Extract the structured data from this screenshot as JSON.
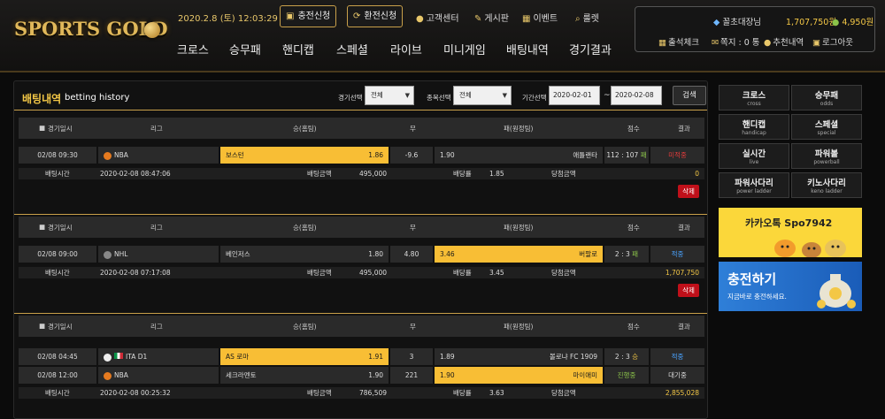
{
  "header": {
    "logo": "SPORTS GOLD",
    "datetime": "2020.2.8 (토) 12:03:29",
    "charge_btn": "충전신청",
    "exchange_btn": "환전신청",
    "links": [
      "고객센터",
      "게시판",
      "이벤트",
      "룰렛"
    ],
    "nav": [
      "크로스",
      "승무패",
      "핸디캡",
      "스페셜",
      "라이브",
      "미니게임",
      "배팅내역",
      "경기결과"
    ]
  },
  "user": {
    "name": "꼴초대장님",
    "money": "1,707,750원",
    "point": "4,950원",
    "links": [
      "출석체크",
      "쪽지 : 0 통",
      "추천내역",
      "로그아웃"
    ]
  },
  "page": {
    "title": "배팅내역",
    "subtitle": "betting history",
    "filter_game_label": "경기선택",
    "filter_game_value": "전체",
    "filter_sport_label": "종목선택",
    "filter_sport_value": "전체",
    "filter_period_label": "기간선택",
    "date_from": "2020-02-01",
    "date_to": "2020-02-08",
    "search": "검색"
  },
  "columns": [
    "경기일시",
    "리그",
    "승(홈팀)",
    "무",
    "패(원정팀)",
    "점수",
    "결과"
  ],
  "info_labels": {
    "bet_time": "배팅시간",
    "bet_amount": "배팅금액",
    "odds": "배당률",
    "win_amount": "당첨금액",
    "delete": "삭제"
  },
  "bets": [
    {
      "games": [
        {
          "date": "02/08 09:30",
          "league": "NBA",
          "home": "보스턴",
          "home_odds": "1.86",
          "draw": "-9.6",
          "away": "애틀랜타",
          "away_odds": "1.90",
          "score": "112 : 107",
          "mark": "패",
          "result": "미적중"
        }
      ],
      "bet_time": "2020-02-08 08:47:06",
      "amount": "495,000",
      "odds": "1.85",
      "win": "0"
    },
    {
      "games": [
        {
          "date": "02/08 09:00",
          "league": "NHL",
          "home": "베인저스",
          "home_odds": "1.80",
          "draw": "4.80",
          "away": "버팔로",
          "away_odds": "3.46",
          "score": "2 : 3",
          "mark": "패",
          "result": "적중"
        }
      ],
      "bet_time": "2020-02-08 07:17:08",
      "amount": "495,000",
      "odds": "3.45",
      "win": "1,707,750"
    },
    {
      "games": [
        {
          "date": "02/08 04:45",
          "league": "ITA D1",
          "home": "AS 로마",
          "home_odds": "1.91",
          "draw": "3",
          "away": "볼로냐 FC 1909",
          "away_odds": "1.89",
          "score": "2 : 3",
          "mark": "승",
          "result": "적중"
        },
        {
          "date": "02/08 12:00",
          "league": "NBA",
          "home": "세크라멘토",
          "home_odds": "1.90",
          "draw": "221",
          "away": "마이애미",
          "away_odds": "1.90",
          "score": "",
          "mark": "",
          "result": "진행중",
          "result2": "대기중"
        }
      ],
      "bet_time": "2020-02-08 00:25:32",
      "amount": "786,509",
      "odds": "3.63",
      "win": "2,855,028"
    }
  ],
  "side_menu": [
    {
      "k": "크로스",
      "e": "cross"
    },
    {
      "k": "승무패",
      "e": "odds"
    },
    {
      "k": "핸디캡",
      "e": "handicap"
    },
    {
      "k": "스페셜",
      "e": "special"
    },
    {
      "k": "실시간",
      "e": "live"
    },
    {
      "k": "파워볼",
      "e": "powerball"
    },
    {
      "k": "파워사다리",
      "e": "power ladder"
    },
    {
      "k": "키노사다리",
      "e": "keno ladder"
    }
  ],
  "kakao": "카카오톡 Spo7942",
  "charge_banner": {
    "title": "충전하기",
    "sub": "지금바로 충전하세요."
  },
  "colors": {
    "gold": "#f8be35",
    "accent": "#c9a04a",
    "lose": "#e23b3b",
    "win": "#4aa3ff",
    "delete": "#c0101a"
  }
}
